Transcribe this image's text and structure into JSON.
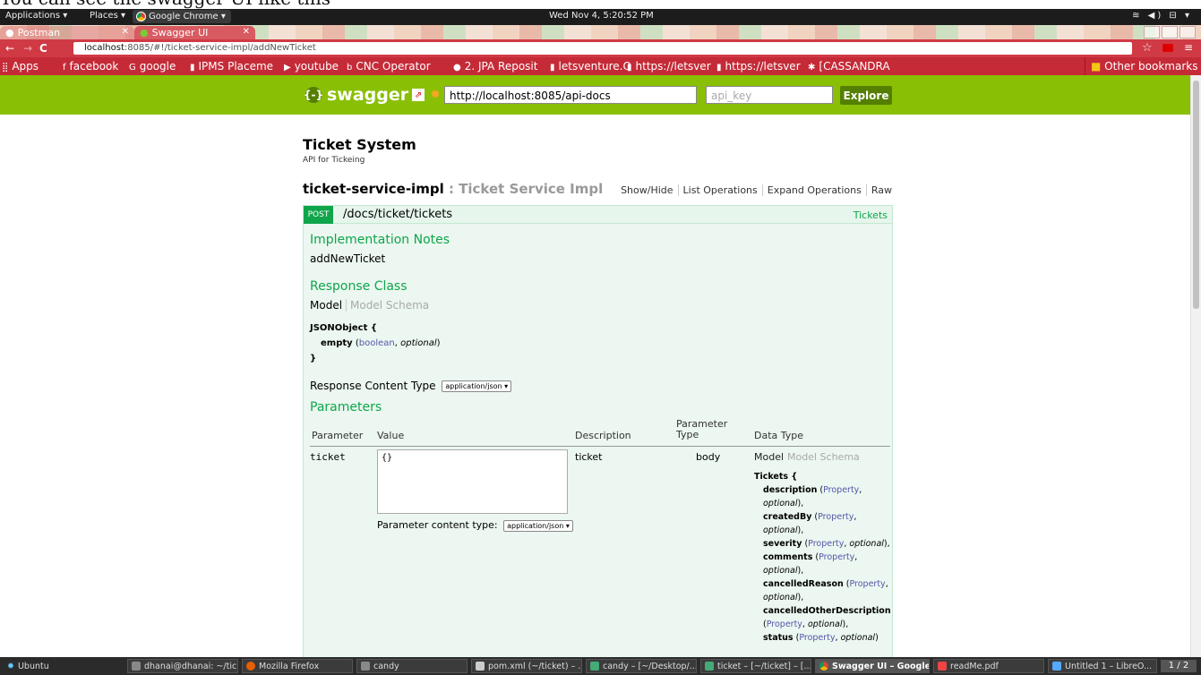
{
  "caption": "You can see the swagger UI like this",
  "topbar": {
    "applications": "Applications ▾",
    "places": "Places ▾",
    "app_menu": "Google Chrome ▾",
    "clock": "Wed Nov  4,  5:20:52 PM",
    "tray": "≋ ◀) ⊟ ▾"
  },
  "tabs": [
    {
      "label": "Postman"
    },
    {
      "label": "Swagger UI"
    }
  ],
  "address": {
    "host": "localhost",
    "rest": ":8085/#!/ticket-service-impl/addNewTicket"
  },
  "bookmarks": [
    {
      "label": "Apps",
      "icon": "apps-icon"
    },
    {
      "label": "facebook",
      "icon": "facebook-icon"
    },
    {
      "label": "google",
      "icon": "google-icon"
    },
    {
      "label": "IPMS Placeme",
      "icon": "page-icon"
    },
    {
      "label": "youtube",
      "icon": "youtube-icon"
    },
    {
      "label": "CNC Operator",
      "icon": "bookmark-icon"
    },
    {
      "label": "2. JPA Reposit",
      "icon": "spring-icon"
    },
    {
      "label": "letsventure.O",
      "icon": "page-icon"
    },
    {
      "label": "https://letsver",
      "icon": "page-icon"
    },
    {
      "label": "https://letsver",
      "icon": "page-icon"
    },
    {
      "label": "[CASSANDRA",
      "icon": "cassandra-icon"
    }
  ],
  "other_bookmarks": "Other bookmarks",
  "swagger": {
    "logo": "swagger",
    "url": "http://localhost:8085/api-docs",
    "api_key_placeholder": "api_key",
    "explore": "Explore"
  },
  "api": {
    "title": "Ticket System",
    "description": "API for Tickeing"
  },
  "resource": {
    "name": "ticket-service-impl",
    "separator": " : ",
    "description": "Ticket Service Impl",
    "links": [
      "Show/Hide",
      "List Operations",
      "Expand Operations",
      "Raw"
    ]
  },
  "operation": {
    "method": "POST",
    "path": "/docs/ticket/tickets",
    "tag": "Tickets",
    "impl_notes_title": "Implementation Notes",
    "impl_notes": "addNewTicket",
    "response_class_title": "Response Class",
    "model_tab": "Model",
    "schema_tab": "Model Schema",
    "response_model": {
      "name": "JSONObject {",
      "field": "empty",
      "type": "boolean",
      "optional": "optional",
      "close": "}"
    },
    "response_content_type_label": "Response Content Type",
    "response_content_type": "application/json",
    "parameters_title": "Parameters",
    "param_headers": [
      "Parameter",
      "Value",
      "Description",
      "Parameter Type",
      "Data Type"
    ],
    "param": {
      "name": "ticket",
      "value": "{}",
      "content_type_label": "Parameter content type:",
      "content_type": "application/json",
      "description": "ticket",
      "param_type": "body"
    },
    "tickets_model": {
      "name": "Tickets {",
      "fields": [
        {
          "name": "description",
          "type": "Property",
          "optional": "optional"
        },
        {
          "name": "createdBy",
          "type": "Property",
          "optional": "optional"
        },
        {
          "name": "severity",
          "type": "Property",
          "optional": "optional"
        },
        {
          "name": "comments",
          "type": "Property",
          "optional": "optional"
        },
        {
          "name": "cancelledReason",
          "type": "Property",
          "optional": "optional"
        },
        {
          "name": "cancelledOtherDescription",
          "type": "Property",
          "optional": "optional"
        },
        {
          "name": "status",
          "type": "Property",
          "optional": "optional"
        }
      ]
    }
  },
  "taskbar": {
    "start": "Ubuntu",
    "tasks": [
      "dhanai@dhanai: ~/tic...",
      "Mozilla Firefox",
      "candy",
      "pom.xml (~/ticket) – ...",
      "candy – [~/Desktop/...",
      "ticket – [~/ticket] – [...",
      "Swagger UI – Google...",
      "readMe.pdf",
      "Untitled 1 – LibreO..."
    ],
    "pager": "1 / 2"
  },
  "colors": {
    "swagger_green": "#89bf04",
    "post_green": "#10a54a",
    "chrome_red": "#c52a37"
  }
}
